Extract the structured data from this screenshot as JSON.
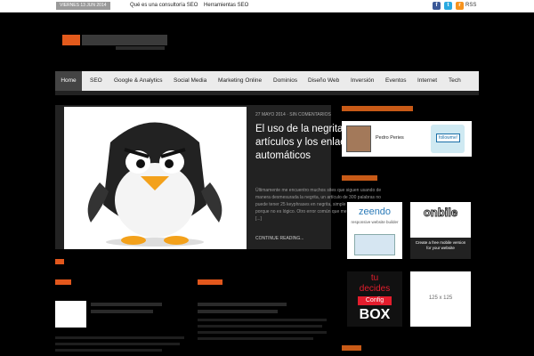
{
  "topbar": {
    "date": "VIERNES 13 JUN 2014",
    "links": [
      "Qué es una consultoría SEO",
      "Herramientas SEO"
    ],
    "rss_label": "RSS"
  },
  "nav": {
    "items": [
      "Home",
      "SEO",
      "Google & Analytics",
      "Social Media",
      "Marketing Online",
      "Dominios",
      "Diseño Web",
      "Inversión",
      "Eventos",
      "Internet",
      "Tech"
    ]
  },
  "featured": {
    "meta": "27 MAYO 2014 · SIN COMENTARIOS",
    "title": "El uso de la negrita en los artículos y los enlaces automáticos",
    "excerpt": "Últimamente me encuentro muchos sites que siguen usando de manera desmesurada la negrita, un artículo de 300 palabras no puede tener 25 keyphrases en negrita, simple y llanamente porque no es lógico. Otro error común que me encuentro es que [...]",
    "continue": "CONTINUE READING..."
  },
  "sidebar": {
    "profile_name": "Pedro Peries",
    "follow_label": "followme!",
    "ad_zeendo": {
      "title": "zeendo",
      "subtitle": "responsive website builder"
    },
    "ad_onbile": {
      "title": "onbile",
      "subtitle": "Create a free mobile version for your website"
    },
    "ad_tudecides": {
      "line1": "tu",
      "line2": "decides",
      "line3": "Config",
      "line4": "BOX"
    },
    "ad_placeholder": "125 x 125"
  },
  "colors": {
    "accent": "#e2571c",
    "background": "#000000",
    "nav_bg": "#ebebeb",
    "nav_active": "#444444"
  }
}
